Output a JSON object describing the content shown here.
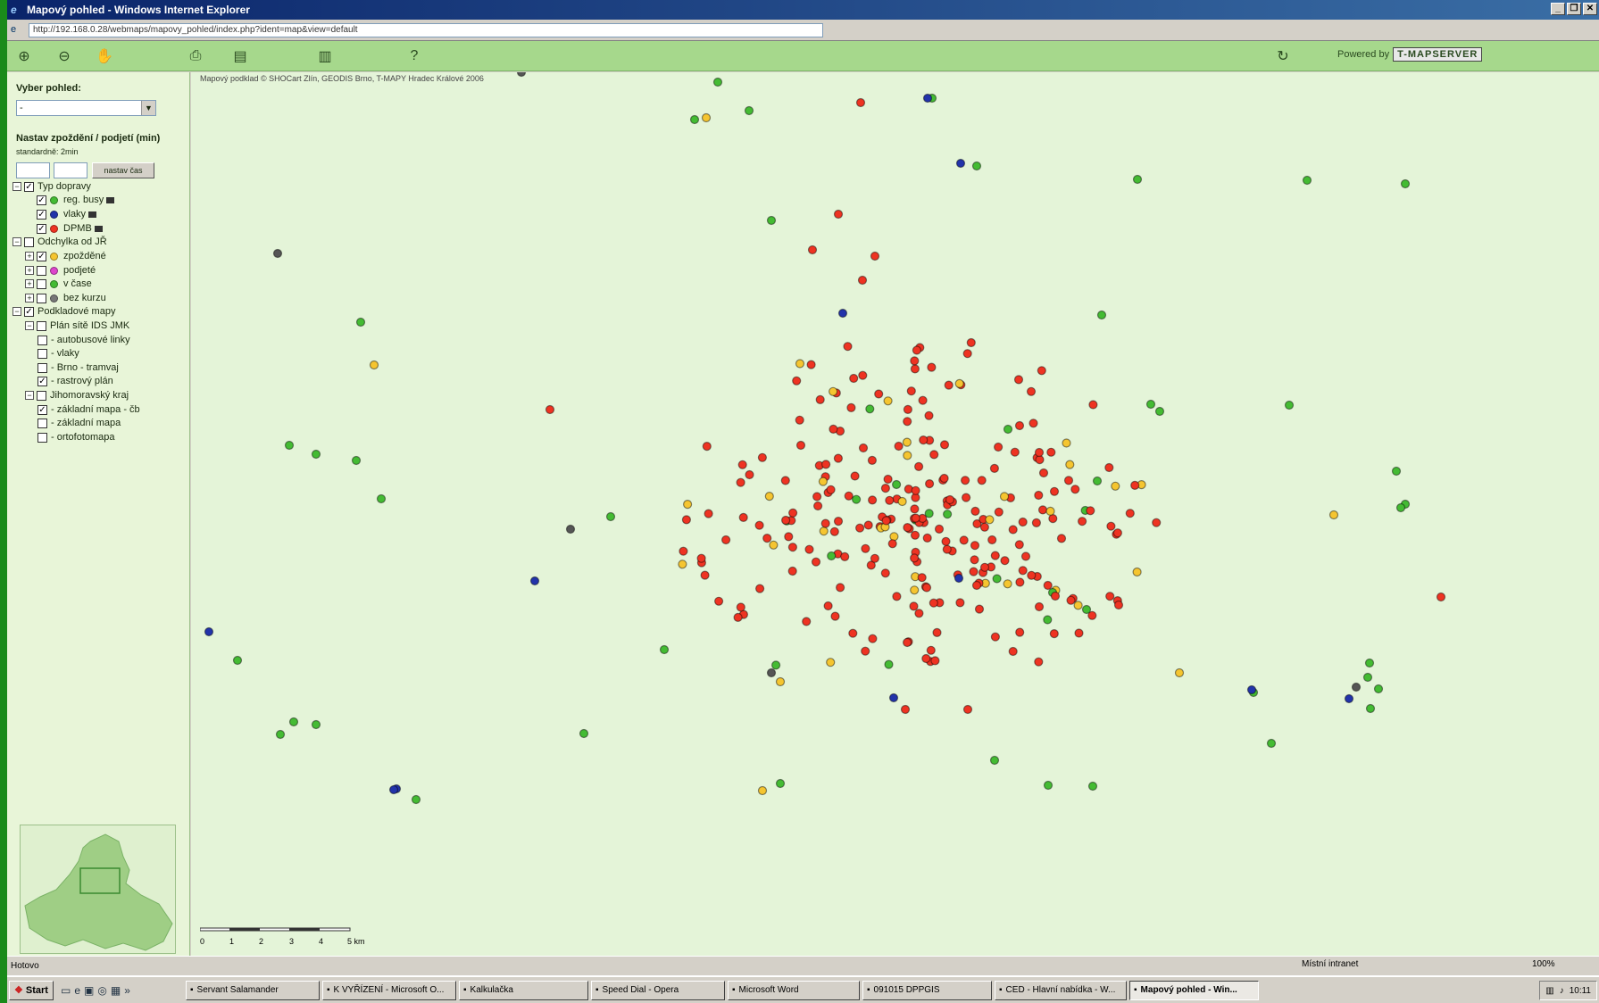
{
  "window": {
    "title": "Mapový pohled - Windows Internet Explorer",
    "minimize": "_",
    "restore": "❐",
    "close": "✕"
  },
  "address": {
    "url": "http://192.168.0.28/webmaps/mapovy_pohled/index.php?ident=map&view=default"
  },
  "toolbar": {
    "powered_by": "Powered by",
    "logo_text": "T-MAPSERVER",
    "tools": [
      "zoom-in-icon",
      "zoom-out-icon",
      "pan-icon",
      "print-icon",
      "measure-icon",
      "chart-icon",
      "help-icon",
      "refresh-icon"
    ]
  },
  "sidebar": {
    "select_view_label": "Vyber pohled:",
    "select_view_value": "-",
    "delay_label": "Nastav zpoždění / podjetí (min)",
    "delay_hint": "standardně: 2min",
    "set_time_button": "nastav čas",
    "tree": [
      {
        "label": "Typ dopravy",
        "checked": true,
        "level": 0,
        "expander": "−"
      },
      {
        "label": "reg. busy",
        "checked": true,
        "level": 1,
        "dot": "#44bb33",
        "sq": true
      },
      {
        "label": "vlaky",
        "checked": true,
        "level": 1,
        "dot": "#2233aa",
        "sq": true
      },
      {
        "label": "DPMB",
        "checked": true,
        "level": 1,
        "dot": "#ee3322",
        "sq": true
      },
      {
        "label": "Odchylka od JŘ",
        "checked": false,
        "level": 0,
        "expander": "−"
      },
      {
        "label": "zpožděné",
        "checked": true,
        "level": 1,
        "dot": "#f5c530",
        "expander": "+"
      },
      {
        "label": "podjeté",
        "checked": false,
        "level": 1,
        "dot": "#dd44cc",
        "expander": "+"
      },
      {
        "label": "v čase",
        "checked": false,
        "level": 1,
        "dot": "#44bb33",
        "expander": "+"
      },
      {
        "label": "bez kurzu",
        "checked": false,
        "level": 1,
        "dot": "#777777",
        "expander": "+"
      },
      {
        "label": "Podkladové mapy",
        "checked": true,
        "level": 0,
        "expander": "−"
      },
      {
        "label": "Plán sítě IDS JMK",
        "checked": false,
        "level": 1,
        "expander": "−"
      },
      {
        "label": "- autobusové linky",
        "checked": false,
        "level": 2
      },
      {
        "label": "- vlaky",
        "checked": false,
        "level": 2
      },
      {
        "label": "- Brno - tramvaj",
        "checked": false,
        "level": 2
      },
      {
        "label": "- rastrový plán",
        "checked": true,
        "level": 2
      },
      {
        "label": "Jihomoravský kraj",
        "checked": false,
        "level": 1,
        "expander": "−"
      },
      {
        "label": "- základní mapa - čb",
        "checked": true,
        "level": 2
      },
      {
        "label": "- základní mapa",
        "checked": false,
        "level": 2
      },
      {
        "label": "- ortofotomapa",
        "checked": false,
        "level": 2
      }
    ]
  },
  "map": {
    "copyright": "Mapový podklad © SHOCart Zlín, GEODIS Brno, T-MAPY Hradec Králové 2006",
    "scale_labels": [
      "0",
      "1",
      "2",
      "3",
      "4",
      "5 km"
    ],
    "colors": {
      "background": "#e4f4d8",
      "bus": "#44bb33",
      "train": "#2233aa",
      "tram": "#ee3322",
      "delayed": "#f5c530",
      "no_course": "#555555"
    }
  },
  "status": {
    "left": "Hotovo",
    "zone": "Místní intranet",
    "zoom": "100%"
  },
  "taskbar": {
    "start": "Start",
    "tasks": [
      "Servant Salamander",
      "K VYŘÍZENÍ - Microsoft O...",
      "Kalkulačka",
      "Speed Dial - Opera",
      "Microsoft Word",
      "091015 DPPGIS",
      "CED - Hlavní nabídka - W...",
      "Mapový pohled - Win..."
    ],
    "active_index": 7,
    "clock": "10:11"
  }
}
